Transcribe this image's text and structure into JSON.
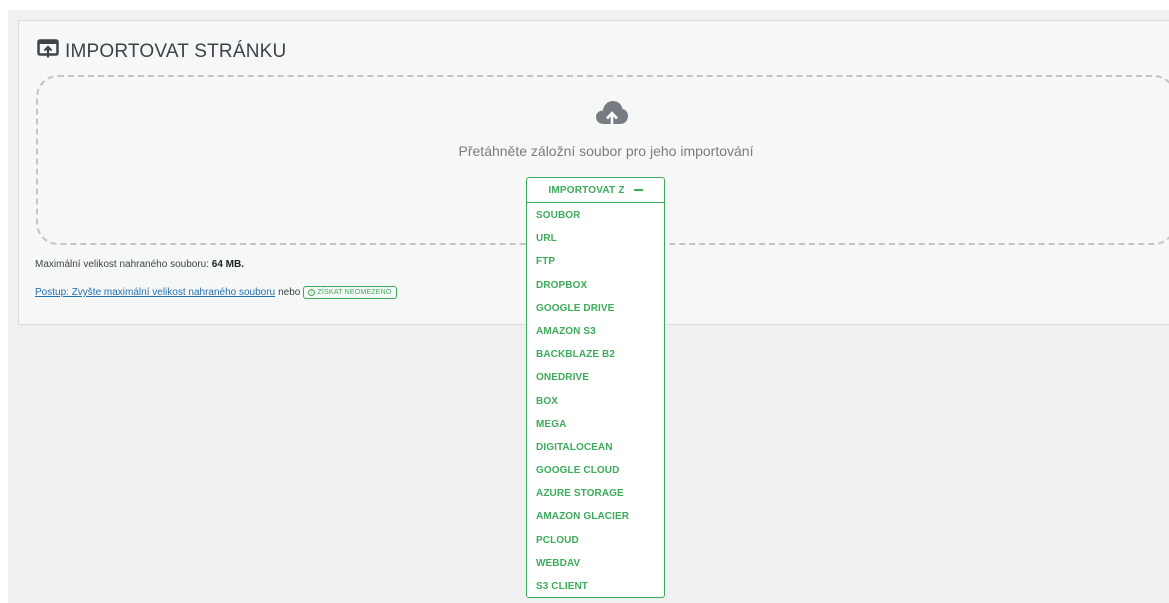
{
  "panel": {
    "title": "IMPORTOVAT STRÁNKU",
    "drop_text": "Přetáhněte záložní soubor pro jeho importování",
    "max_size_label": "Maximální velikost nahraného souboru:",
    "max_size_value": "64 MB.",
    "howto_link": "Postup: Zvyšte maximální velikost nahraného souboru",
    "or_text": "nebo",
    "get_unlimited_label": "ZÍSKAT NEOMEZENO"
  },
  "dropdown": {
    "label": "IMPORTOVAT Z",
    "items": [
      {
        "label": "SOUBOR"
      },
      {
        "label": "URL"
      },
      {
        "label": "FTP"
      },
      {
        "label": "DROPBOX"
      },
      {
        "label": "GOOGLE DRIVE"
      },
      {
        "label": "AMAZON S3"
      },
      {
        "label": "BACKBLAZE B2"
      },
      {
        "label": "ONEDRIVE"
      },
      {
        "label": "BOX"
      },
      {
        "label": "MEGA"
      },
      {
        "label": "DIGITALOCEAN"
      },
      {
        "label": "GOOGLE CLOUD"
      },
      {
        "label": "AZURE STORAGE"
      },
      {
        "label": "AMAZON GLACIER"
      },
      {
        "label": "PCLOUD"
      },
      {
        "label": "WEBDAV"
      },
      {
        "label": "S3 CLIENT"
      }
    ]
  },
  "colors": {
    "accent": "#3dab5b",
    "link": "#2271b1",
    "icon": "#787c82"
  },
  "icons": {
    "title_icon": "import-screen-icon",
    "upload_icon": "cloud-upload-icon",
    "info_icon": "info-icon",
    "collapse_icon": "minus-icon"
  }
}
